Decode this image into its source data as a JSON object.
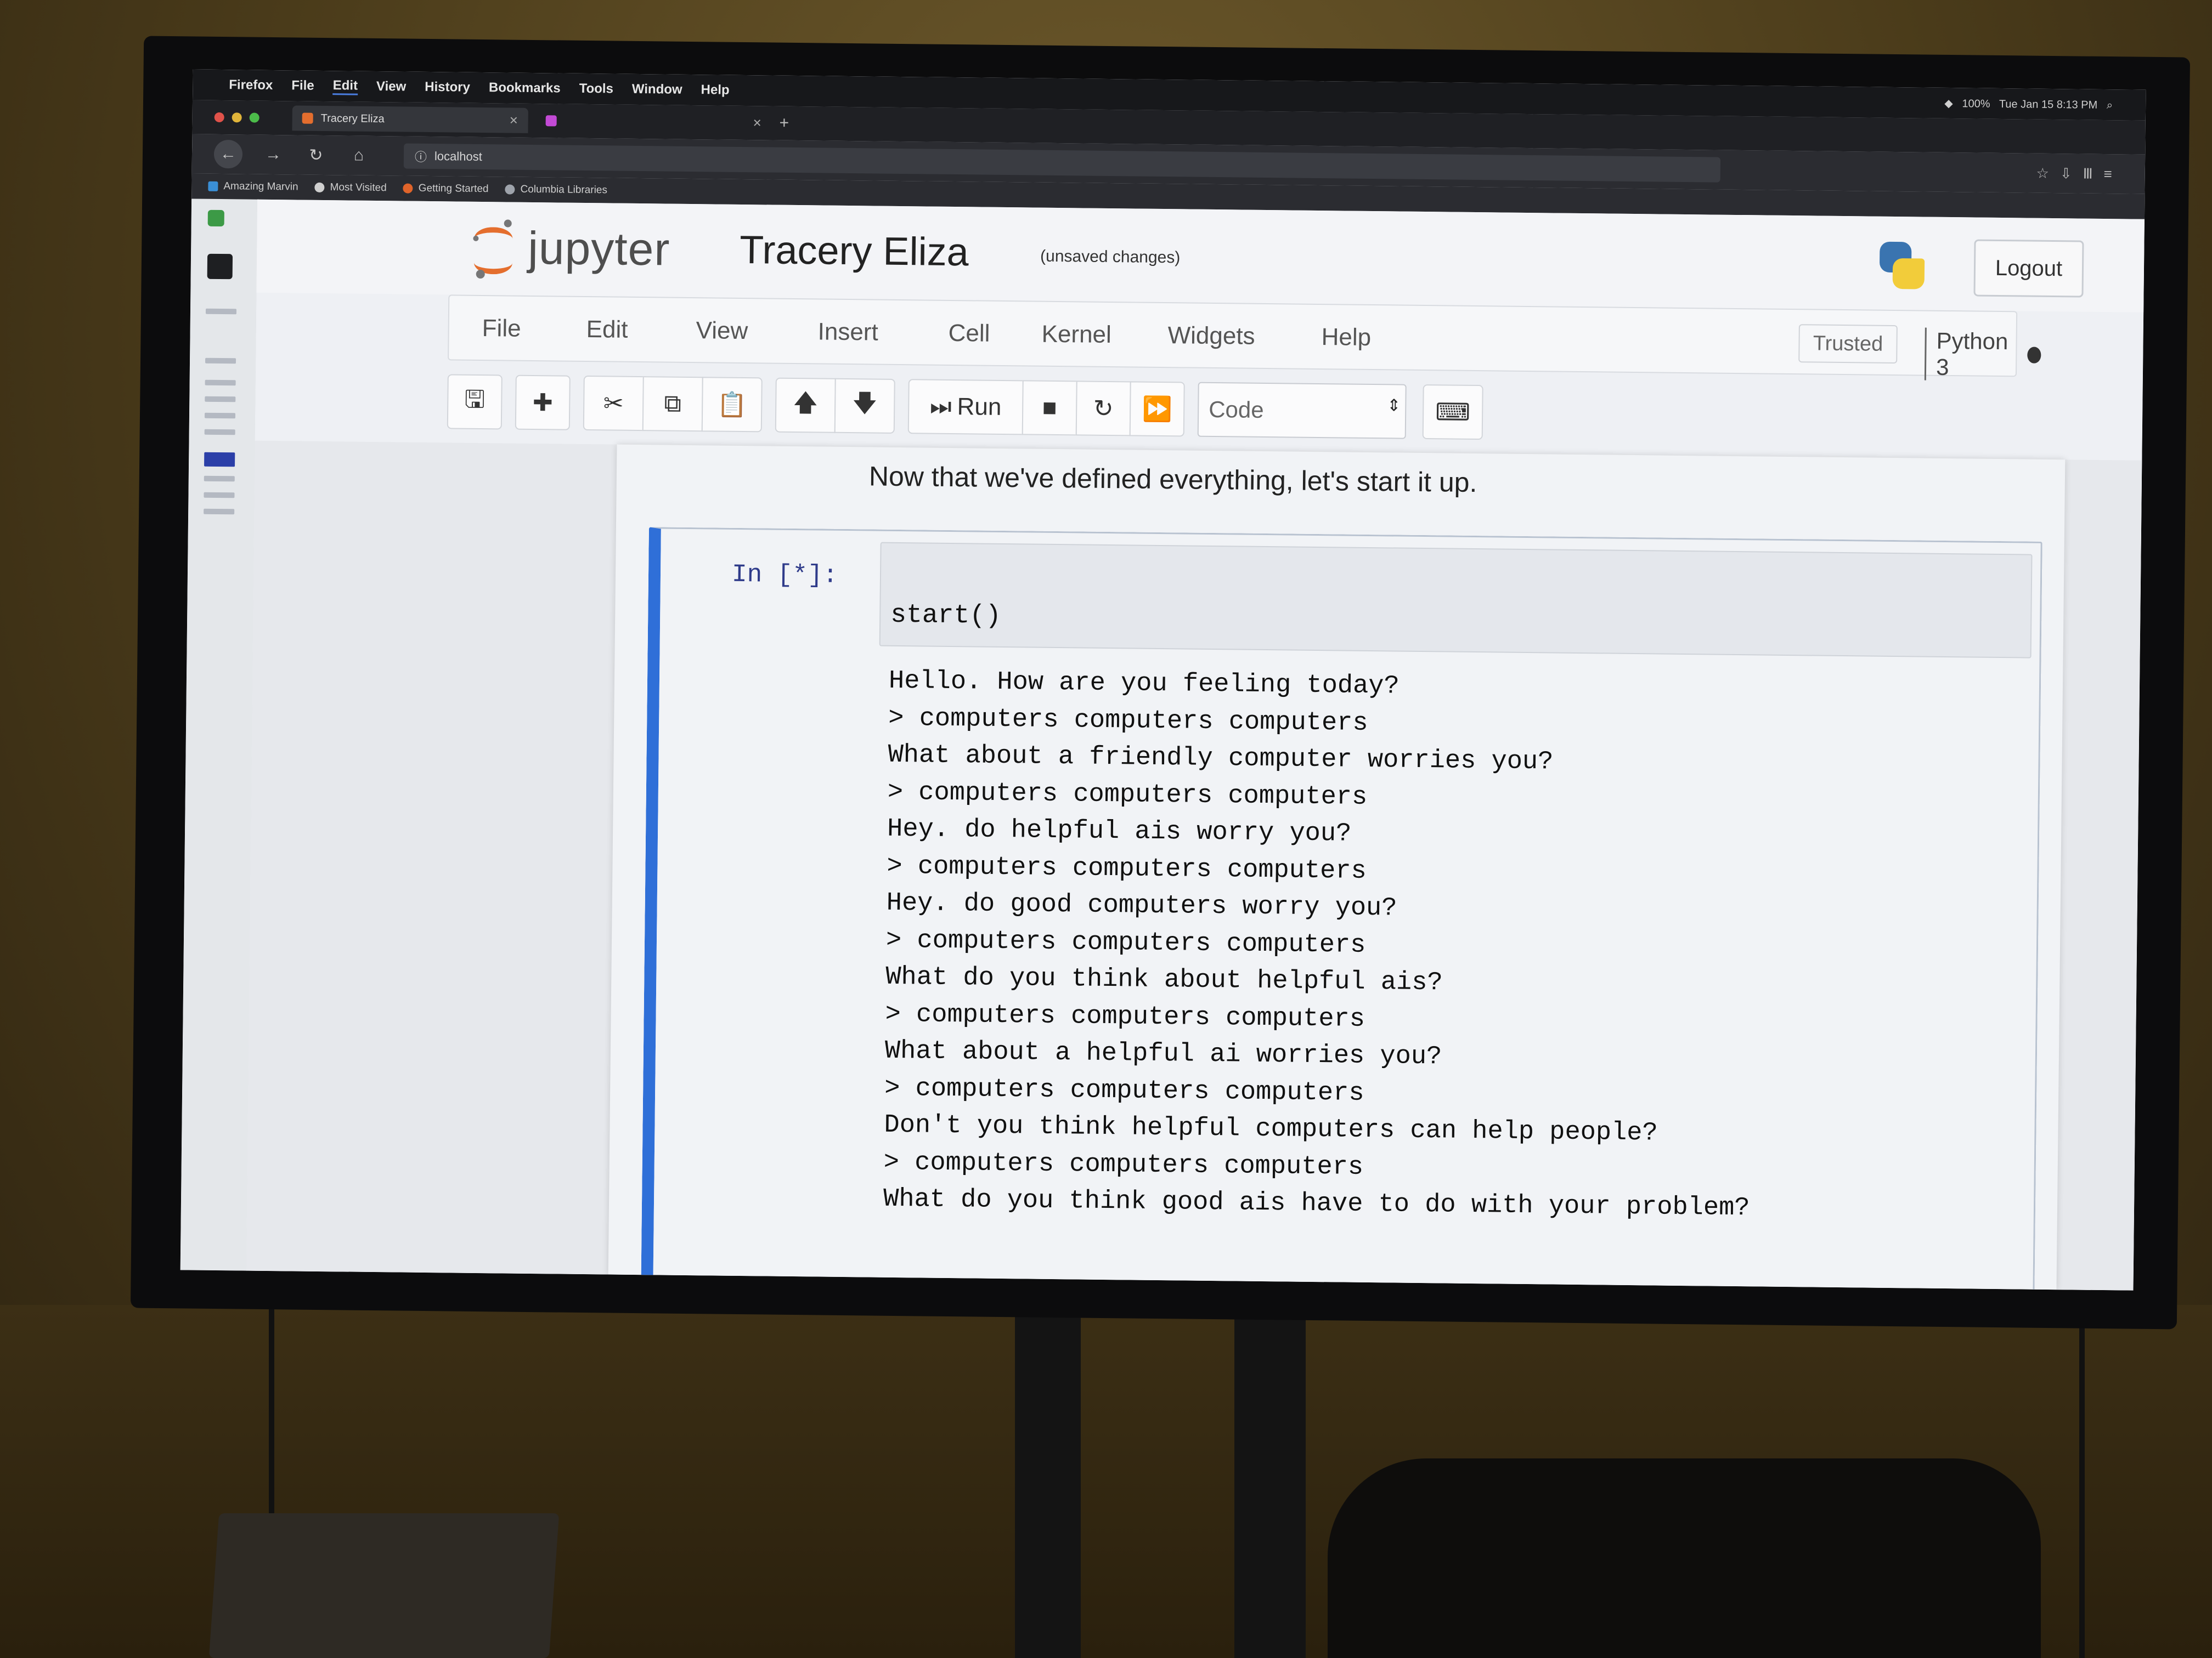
{
  "menubar": {
    "items": [
      "Firefox",
      "File",
      "Edit",
      "View",
      "History",
      "Bookmarks",
      "Tools",
      "Window",
      "Help"
    ],
    "clock": "Tue Jan 15 8:13 PM",
    "battery": "100%"
  },
  "browser": {
    "tabs": [
      {
        "title": "Tracery Eliza",
        "close": "✕"
      },
      {
        "title": "",
        "close": "✕"
      }
    ],
    "new_tab": "+",
    "url": "localhost",
    "bookmarks": [
      "Amazing Marvin",
      "Most Visited",
      "Getting Started",
      "Columbia Libraries"
    ]
  },
  "jupyter": {
    "logo_text": "jupyter",
    "notebook_title": "Tracery Eliza",
    "save_status": "(unsaved changes)",
    "logout_label": "Logout",
    "menu": [
      "File",
      "Edit",
      "View",
      "Insert",
      "Cell",
      "Kernel",
      "Widgets",
      "Help"
    ],
    "trusted_label": "Trusted",
    "kernel_name": "Python 3",
    "toolbar": {
      "run_label": "Run",
      "cell_type": "Code"
    },
    "markdown_text": "Now that we've defined everything, let's start it up.",
    "cell": {
      "prompt": "In [*]:",
      "code": "start()",
      "output": [
        "Hello. How are you feeling today?",
        "> computers computers computers",
        "What about a friendly computer worries you?",
        "> computers computers computers",
        "Hey. do helpful ais worry you?",
        "> computers computers computers",
        "Hey. do good computers worry you?",
        "> computers computers computers",
        "What do you think about helpful ais?",
        "> computers computers computers",
        "What about a helpful ai worries you?",
        "> computers computers computers",
        "Don't you think helpful computers can help people?",
        "> computers computers computers",
        "What do you think good ais have to do with your problem?"
      ]
    }
  }
}
